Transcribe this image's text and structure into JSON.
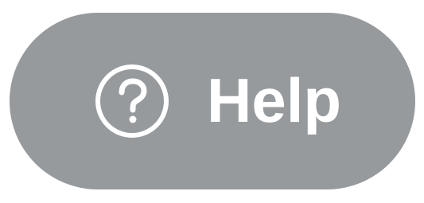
{
  "help_button": {
    "label": "Help",
    "icon": "question-circle-icon",
    "background_color": "#969a9d",
    "foreground_color": "#ffffff"
  }
}
